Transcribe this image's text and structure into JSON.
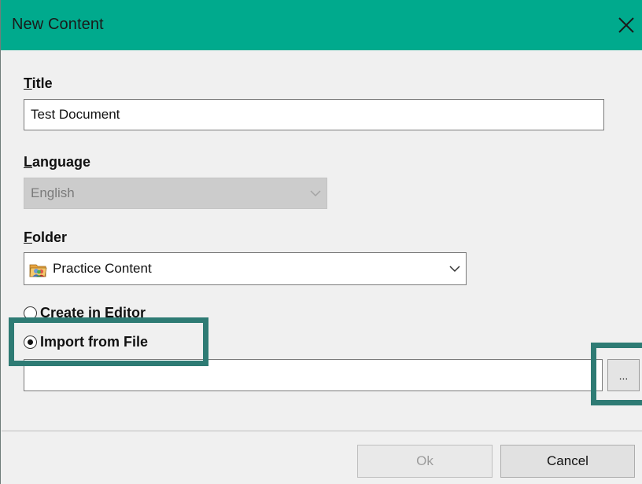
{
  "window": {
    "title": "New Content"
  },
  "title_field": {
    "label": "Title",
    "label_accel": "T",
    "label_rest": "itle",
    "value": "Test Document"
  },
  "language_field": {
    "label_accel": "L",
    "label_rest": "anguage",
    "value": "English",
    "disabled": true
  },
  "folder_field": {
    "label_accel": "F",
    "label_rest": "older",
    "value": "Practice Content",
    "icon": "folder-people-icon"
  },
  "options": [
    {
      "label": "Create in Editor",
      "checked": false
    },
    {
      "label": "Import from File",
      "checked": true
    }
  ],
  "file_path": {
    "value": ""
  },
  "browse": {
    "label": "..."
  },
  "buttons": {
    "ok": "Ok",
    "cancel": "Cancel"
  },
  "colors": {
    "titlebar": "#00aa8d",
    "highlight": "#2e7b74"
  }
}
